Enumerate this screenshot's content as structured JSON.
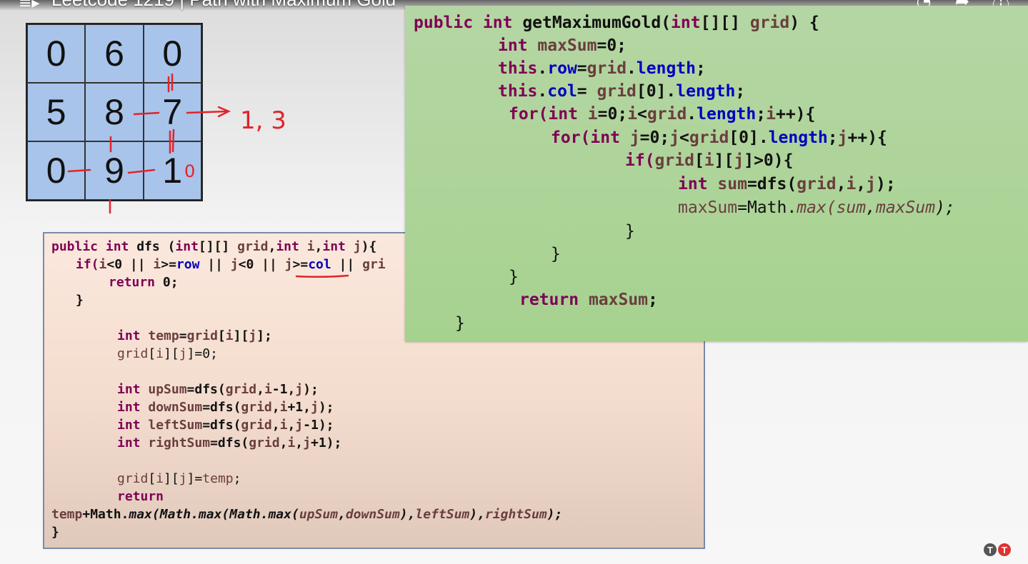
{
  "video": {
    "title": "Leetcode 1219 | Path with Maximum Gold"
  },
  "icons": {
    "menu": "playlist-icon",
    "clock": "watch-later-icon",
    "share": "share-icon",
    "info": "info-icon"
  },
  "grid": {
    "rows": [
      [
        "0",
        "6",
        "0"
      ],
      [
        "5",
        "8",
        "7"
      ],
      [
        "0",
        "9",
        "1"
      ]
    ]
  },
  "annotations": {
    "arrow_note": "1, 3",
    "cell_mark": "0"
  },
  "main_code": {
    "l1_kw": "public int ",
    "l1_fn": "getMaximumGold(",
    "l1_kw2": "int",
    "l1_a": "[][] ",
    "l1_var": "grid",
    "l1_b": ") {",
    "l2_kw": "int ",
    "l2_var": "maxSum",
    "l2_rest": "=0;",
    "l3_kw": "this",
    "l3_a": ".",
    "l3_fld": "row",
    "l3_b": "=",
    "l3_var": "grid",
    "l3_c": ".",
    "l3_fld2": "length",
    "l3_d": ";",
    "l4_kw": "this",
    "l4_a": ".",
    "l4_fld": "col",
    "l4_b": "= ",
    "l4_var": "grid",
    "l4_c": "[0].",
    "l4_fld2": "length",
    "l4_d": ";",
    "l5_kw": "for(",
    "l5_kw2": "int ",
    "l5_var": "i",
    "l5_a": "=0;",
    "l5_var2": "i",
    "l5_b": "<",
    "l5_var3": "grid",
    "l5_c": ".",
    "l5_fld": "length",
    "l5_d": ";",
    "l5_var4": "i",
    "l5_e": "++){",
    "l6_kw": "for(",
    "l6_kw2": "int ",
    "l6_var": "j",
    "l6_a": "=0;",
    "l6_var2": "j",
    "l6_b": "<",
    "l6_var3": "grid",
    "l6_c": "[0].",
    "l6_fld": "length",
    "l6_d": ";",
    "l6_var4": "j",
    "l6_e": "++){",
    "l7_kw": "if(",
    "l7_var": "grid",
    "l7_a": "[",
    "l7_var2": "i",
    "l7_b": "][",
    "l7_var3": "j",
    "l7_c": "]>0){",
    "l8_kw": "int ",
    "l8_var": "sum",
    "l8_a": "=dfs(",
    "l8_var2": "grid",
    "l8_b": ",",
    "l8_var3": "i",
    "l8_c": ",",
    "l8_var4": "j",
    "l8_d": ");",
    "l9_var": "maxSum",
    "l9_a": "=Math.",
    "l9_it": "max(",
    "l9_var2": "sum",
    "l9_b": ",",
    "l9_var3": "maxSum",
    "l9_c": ");",
    "l10": "}",
    "l11": "}",
    "l12": "}",
    "l13_kw": "return ",
    "l13_var": "maxSum",
    "l13_a": ";",
    "l14": "}"
  },
  "dfs_code": {
    "l1_kw": "public int ",
    "l1_fn": "dfs (",
    "l1_kw2": "int",
    "l1_a": "[][] ",
    "l1_var": "grid",
    "l1_b": ",",
    "l1_kw3": "int ",
    "l1_var2": "i",
    "l1_c": ",",
    "l1_kw4": "int ",
    "l1_var3": "j",
    "l1_d": "){",
    "l2_kw": "if(",
    "l2_var": "i",
    "l2_a": "<0 || ",
    "l2_var2": "i",
    "l2_b": ">=",
    "l2_fld": "row",
    "l2_c": " || ",
    "l2_var3": "j",
    "l2_d": "<0 || ",
    "l2_var4": "j",
    "l2_e": ">=",
    "l2_fld2": "col",
    "l2_f": " || ",
    "l2_var5": "gri",
    "l3_kw": "return ",
    "l3_a": "0;",
    "l4": "}",
    "l5_kw": "int ",
    "l5_var": "temp",
    "l5_a": "=",
    "l5_var2": "grid",
    "l5_b": "[",
    "l5_var3": "i",
    "l5_c": "][",
    "l5_var4": "j",
    "l5_d": "];",
    "l6_var": "grid",
    "l6_a": "[",
    "l6_var2": "i",
    "l6_b": "][",
    "l6_var3": "j",
    "l6_c": "]=0;",
    "l7_kw": "int ",
    "l7_var": "upSum",
    "l7_a": "=dfs(",
    "l7_var2": "grid",
    "l7_b": ",",
    "l7_var3": "i",
    "l7_c": "-1,",
    "l7_var4": "j",
    "l7_d": ");",
    "l8_kw": "int ",
    "l8_var": "downSum",
    "l8_a": "=dfs(",
    "l8_var2": "grid",
    "l8_b": ",",
    "l8_var3": "i",
    "l8_c": "+1,",
    "l8_var4": "j",
    "l8_d": ");",
    "l9_kw": "int ",
    "l9_var": "leftSum",
    "l9_a": "=dfs(",
    "l9_var2": "grid",
    "l9_b": ",",
    "l9_var3": "i",
    "l9_c": ",",
    "l9_var4": "j",
    "l9_d": "-1);",
    "l10_kw": "int ",
    "l10_var": "rightSum",
    "l10_a": "=dfs(",
    "l10_var2": "grid",
    "l10_b": ",",
    "l10_var3": "i",
    "l10_c": ",",
    "l10_var4": "j",
    "l10_d": "+1);",
    "l11_var": "grid",
    "l11_a": "[",
    "l11_var2": "i",
    "l11_b": "][",
    "l11_var3": "j",
    "l11_c": "]=",
    "l11_var4": "temp",
    "l11_d": ";",
    "l12_kw": "return",
    "l13_var": "temp",
    "l13_a": "+Math.",
    "l13_it": "max(Math.max(Math.max(",
    "l13_var2": "upSum",
    "l13_b": ",",
    "l13_var3": "downSum",
    "l13_c": "),",
    "l13_var4": "leftSum",
    "l13_d": "),",
    "l13_var5": "rightSum",
    "l13_e": ");",
    "l14": "}"
  },
  "channel_logo": {
    "left": "T",
    "right": "T"
  }
}
